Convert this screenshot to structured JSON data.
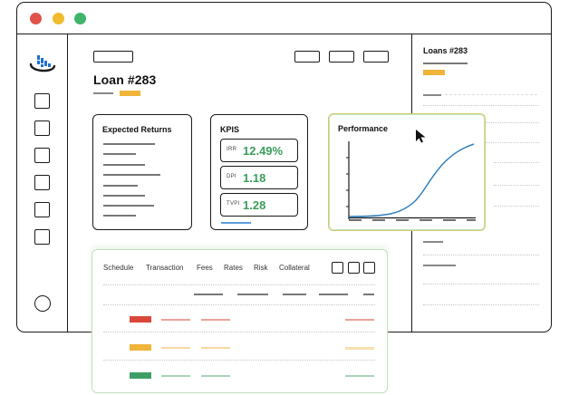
{
  "window": {
    "traffic_lights": {
      "close": "#e0524a",
      "minimize": "#f1bb2e",
      "maximize": "#3fb56b"
    }
  },
  "main": {
    "title": "Loan #283"
  },
  "right_panel": {
    "title": "Loans #283"
  },
  "cards": {
    "expected_returns": {
      "title": "Expected Returns"
    },
    "kpis": {
      "title": "KPIS",
      "items": [
        {
          "label": "IRR",
          "value": "12.49%"
        },
        {
          "label": "DPI",
          "value": "1.18"
        },
        {
          "label": "TVPI",
          "value": "1.28"
        }
      ]
    },
    "performance": {
      "title": "Performance"
    }
  },
  "table": {
    "tabs": [
      "Schedule",
      "Transaction",
      "Fees",
      "Rates",
      "Risk",
      "Collateral"
    ],
    "row_colors": [
      "#d9473b",
      "#f0b43a",
      "#3e9e66"
    ]
  },
  "colors": {
    "accent_yellow": "#f0b43a",
    "kpi_green": "#3a9e5b",
    "chart_line": "#2f7fbf"
  },
  "icons": {
    "logo": "bar-chart-logo-icon",
    "cursor": "mouse-cursor-icon"
  }
}
